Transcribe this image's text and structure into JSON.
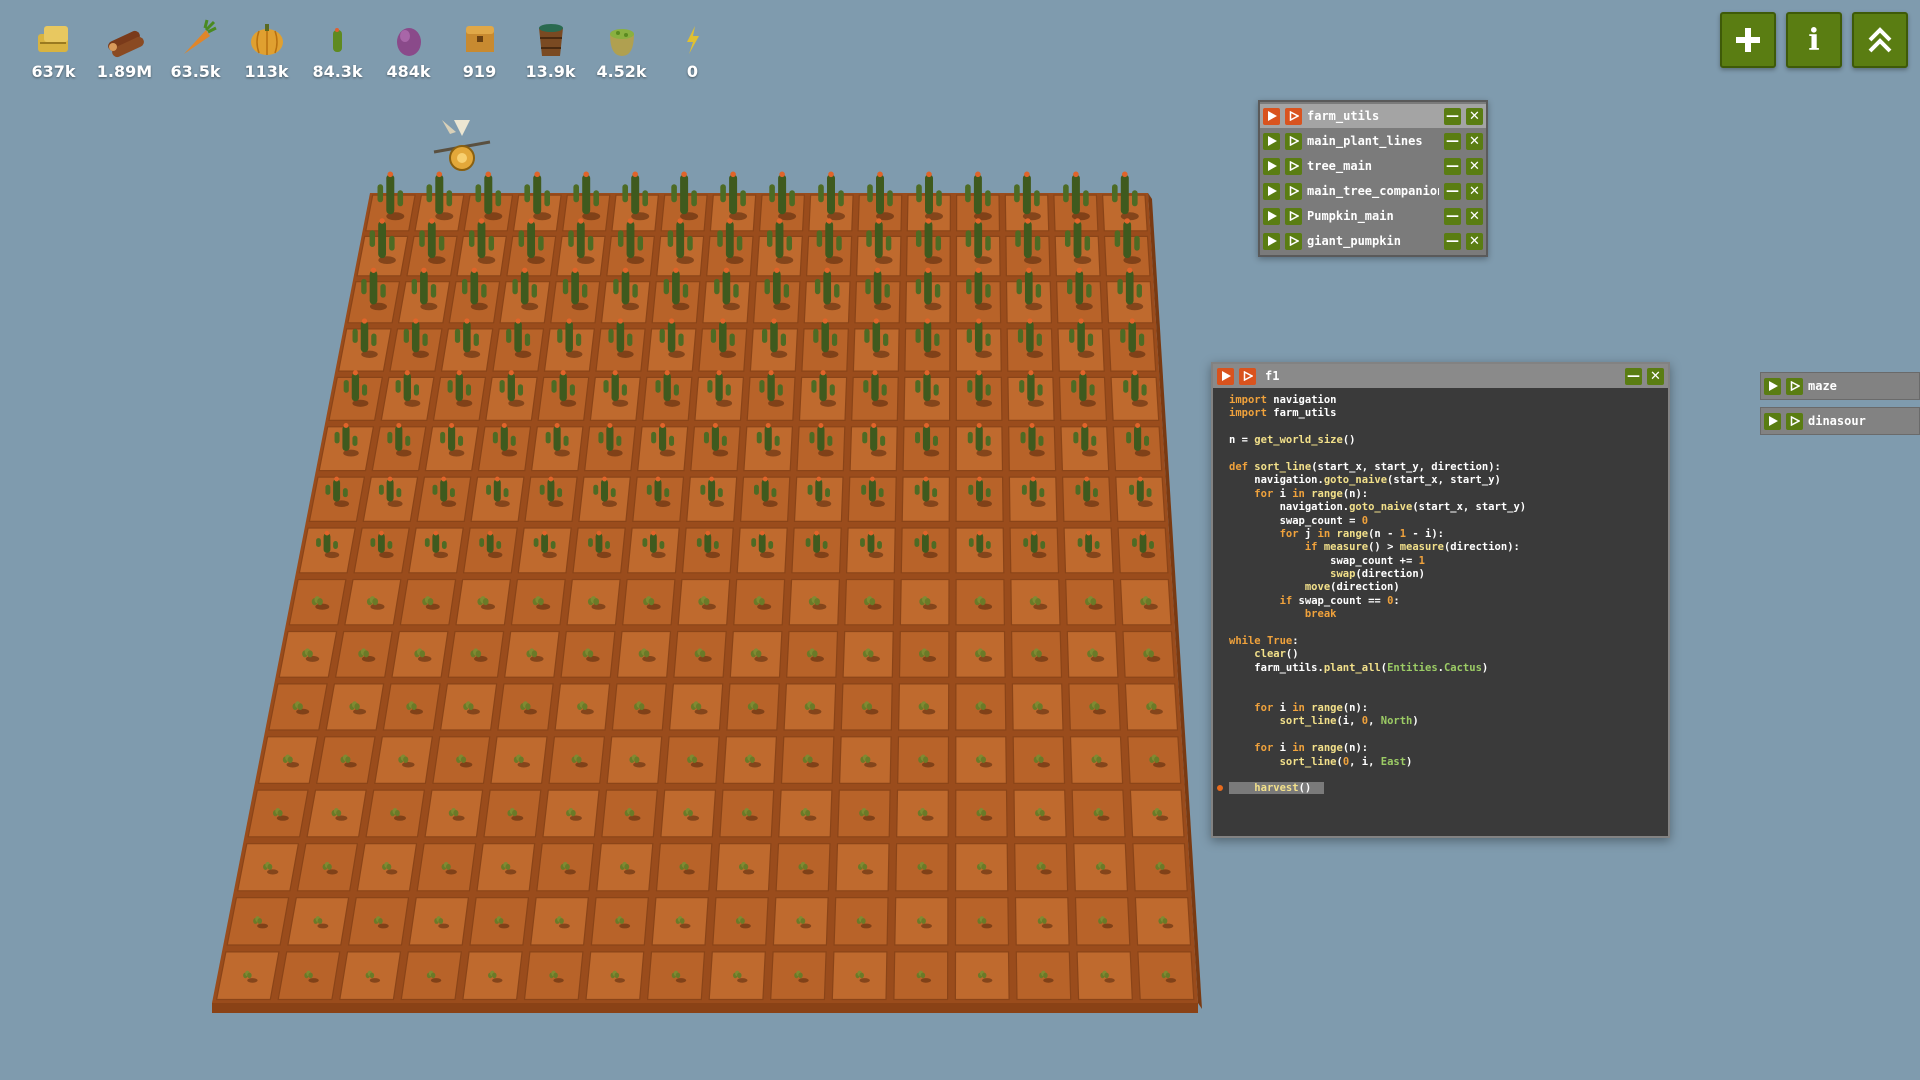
{
  "resources": [
    {
      "icon": "hay-icon",
      "value": "637k",
      "color": "#d9b441"
    },
    {
      "icon": "wood-icon",
      "value": "1.89M",
      "color": "#7a3a1a"
    },
    {
      "icon": "carrot-icon",
      "value": "63.5k",
      "color": "#e0862a"
    },
    {
      "icon": "pumpkin-icon",
      "value": "113k",
      "color": "#e0a030"
    },
    {
      "icon": "cactus-icon",
      "value": "84.3k",
      "color": "#5f8a20"
    },
    {
      "icon": "bone-icon",
      "value": "484k",
      "color": "#8a4a8a"
    },
    {
      "icon": "gold-chest-icon",
      "value": "919",
      "color": "#c88a30"
    },
    {
      "icon": "water-bucket-icon",
      "value": "13.9k",
      "color": "#2a6a50"
    },
    {
      "icon": "fertilizer-icon",
      "value": "4.52k",
      "color": "#b0a050"
    },
    {
      "icon": "power-icon",
      "value": "0",
      "color": "#e0c030"
    }
  ],
  "top_buttons": [
    {
      "name": "add-window-button",
      "label": "+"
    },
    {
      "name": "info-button",
      "label": "i"
    },
    {
      "name": "upgrades-button",
      "label": "^"
    }
  ],
  "scripts": [
    {
      "name": "farm_utils",
      "running": true
    },
    {
      "name": "main_plant_lines",
      "running": false
    },
    {
      "name": "tree_main",
      "running": false
    },
    {
      "name": "main_tree_companion",
      "running": false
    },
    {
      "name": "Pumpkin_main",
      "running": false
    },
    {
      "name": "giant_pumpkin",
      "running": false
    }
  ],
  "code_window": {
    "title": "f1",
    "lines": [
      "import navigation",
      "import farm_utils",
      "",
      "n = get_world_size()",
      "",
      "def sort_line(start_x, start_y, direction):",
      "    navigation.goto_naive(start_x, start_y)",
      "    for i in range(n):",
      "        navigation.goto_naive(start_x, start_y)",
      "        swap_count = 0",
      "        for j in range(n - 1 - i):",
      "            if measure() > measure(direction):",
      "                swap_count += 1",
      "                swap(direction)",
      "            move(direction)",
      "        if swap_count == 0:",
      "            break",
      "",
      "while True:",
      "    clear()",
      "    farm_utils.plant_all(Entities.Cactus)",
      "",
      "",
      "    for i in range(n):",
      "        sort_line(i, 0, North)",
      "",
      "    for i in range(n):",
      "        sort_line(0, i, East)",
      "",
      "    harvest()"
    ],
    "highlight_line": 29
  },
  "side_scripts": [
    {
      "name": "maze"
    },
    {
      "name": "dinasour"
    }
  ],
  "colors": {
    "background": "#7f9bae",
    "soil": "#b5622a",
    "button_green": "#5a7d12",
    "run_orange": "#d9531e"
  }
}
